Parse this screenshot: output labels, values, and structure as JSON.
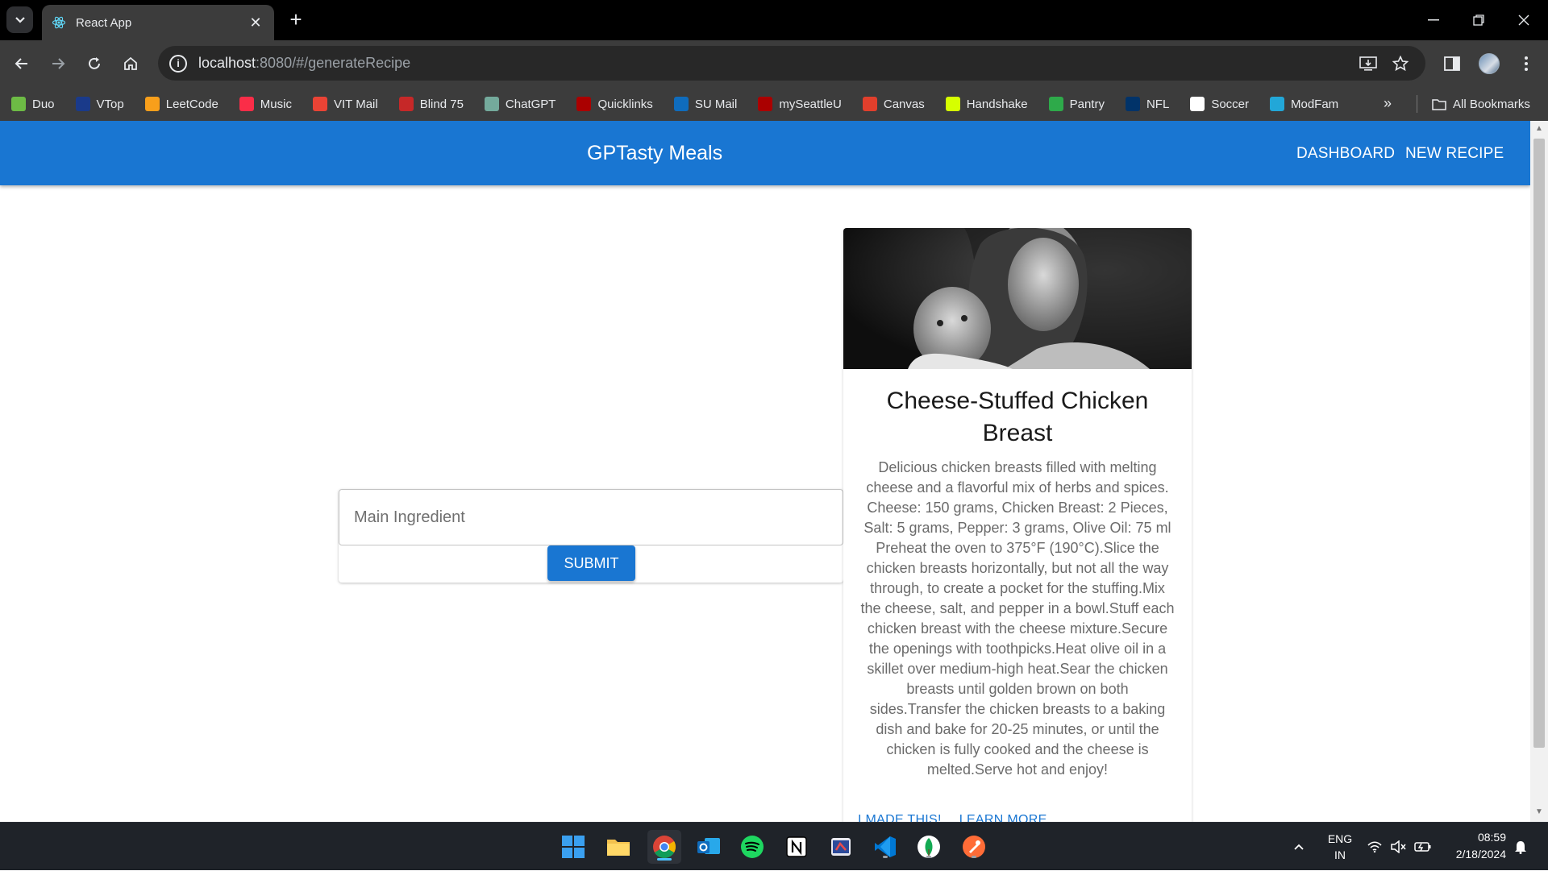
{
  "browser": {
    "tab_title": "React App",
    "url_host": "localhost",
    "url_rest": ":8080/#/generateRecipe",
    "bookmarks": [
      {
        "label": "Duo",
        "color": "#6dbb45"
      },
      {
        "label": "VTop",
        "color": "#1a3a8a"
      },
      {
        "label": "LeetCode",
        "color": "#f89f1b"
      },
      {
        "label": "Music",
        "color": "#fa2d48"
      },
      {
        "label": "VIT Mail",
        "color": "#ea4335"
      },
      {
        "label": "Blind 75",
        "color": "#c62828"
      },
      {
        "label": "ChatGPT",
        "color": "#74aa9c"
      },
      {
        "label": "Quicklinks",
        "color": "#aa0000"
      },
      {
        "label": "SU Mail",
        "color": "#0f6cbd"
      },
      {
        "label": "mySeattleU",
        "color": "#aa0000"
      },
      {
        "label": "Canvas",
        "color": "#e13f2c"
      },
      {
        "label": "Handshake",
        "color": "#d6ff00"
      },
      {
        "label": "Pantry",
        "color": "#2eaa4a"
      },
      {
        "label": "NFL",
        "color": "#013369"
      },
      {
        "label": "Soccer",
        "color": "#ffffff"
      },
      {
        "label": "ModFam",
        "color": "#22a7d8"
      }
    ],
    "all_bookmarks": "All Bookmarks"
  },
  "app": {
    "brand": "GPTasty Meals",
    "nav": {
      "dashboard": "Dashboard",
      "new_recipe": "New Recipe"
    },
    "accent": "#1976d2"
  },
  "form": {
    "placeholder": "Main Ingredient",
    "submit": "Submit"
  },
  "recipe": {
    "title": "Cheese-Stuffed Chicken Breast",
    "description": "Delicious chicken breasts filled with melting cheese and a flavorful mix of herbs and spices.",
    "ingredients": "Cheese: 150 grams, Chicken Breast: 2 Pieces, Salt: 5 grams, Pepper: 3 grams, Olive Oil: 75 ml",
    "instructions": "Preheat the oven to 375°F (190°C).Slice the chicken breasts horizontally, but not all the way through, to create a pocket for the stuffing.Mix the cheese, salt, and pepper in a bowl.Stuff each chicken breast with the cheese mixture.Secure the openings with toothpicks.Heat olive oil in a skillet over medium-high heat.Sear the chicken breasts until golden brown on both sides.Transfer the chicken breasts to a baking dish and bake for 20-25 minutes, or until the chicken is fully cooked and the cheese is melted.Serve hot and enjoy!",
    "actions": {
      "made": "I made this!",
      "learn": "Learn more"
    }
  },
  "taskbar": {
    "lang_top": "ENG",
    "lang_bottom": "IN",
    "time": "08:59",
    "date": "2/18/2024"
  }
}
